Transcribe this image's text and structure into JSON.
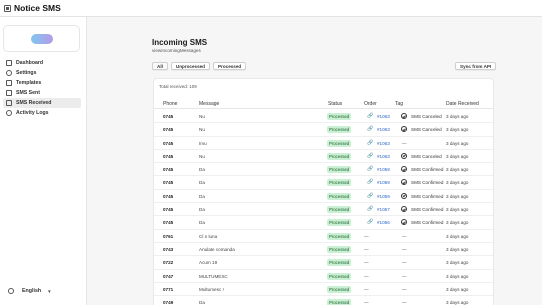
{
  "app": {
    "title": "Notice SMS"
  },
  "sidebar": {
    "items": [
      {
        "label": "Dashboard",
        "icon": "home-icon"
      },
      {
        "label": "Settings",
        "icon": "gear-icon"
      },
      {
        "label": "Templates",
        "icon": "document-icon"
      },
      {
        "label": "SMS Sent",
        "icon": "send-icon"
      },
      {
        "label": "SMS Received",
        "icon": "inbox-icon",
        "active": true
      },
      {
        "label": "Activity Logs",
        "icon": "clock-icon"
      }
    ],
    "language": "English"
  },
  "page": {
    "title": "Incoming SMS",
    "subtitle": "viewIncomingMessages",
    "filters": [
      "All",
      "Unprocessed",
      "Processed"
    ],
    "sync_label": "Sync from API",
    "total": "Total received: 109"
  },
  "table": {
    "columns": [
      "Phone",
      "Message",
      "Status",
      "Order",
      "Tag",
      "Date Received"
    ],
    "rows": [
      {
        "phone": "0745",
        "message": "Nu",
        "status": "Processed",
        "order": "#1063",
        "tag": "SMS Canceled",
        "date": "3 days ago"
      },
      {
        "phone": "0745",
        "message": "Nu",
        "status": "Processed",
        "order": "#1063",
        "tag": "SMS Canceled",
        "date": "3 days ago"
      },
      {
        "phone": "0745",
        "message": "Imu",
        "status": "Processed",
        "order": "#1063",
        "tag": "—",
        "date": "3 days ago"
      },
      {
        "phone": "0745",
        "message": "Nu",
        "status": "Processed",
        "order": "#1063",
        "tag": "SMS Canceled",
        "date": "3 days ago"
      },
      {
        "phone": "0745",
        "message": "Da",
        "status": "Processed",
        "order": "#1059",
        "tag": "SMS Confirmed",
        "date": "3 days ago"
      },
      {
        "phone": "0745",
        "message": "Da",
        "status": "Processed",
        "order": "#1059",
        "tag": "SMS Confirmed",
        "date": "3 days ago"
      },
      {
        "phone": "0745",
        "message": "Da",
        "status": "Processed",
        "order": "#1059",
        "tag": "SMS Confirmed",
        "date": "3 days ago"
      },
      {
        "phone": "0745",
        "message": "Da",
        "status": "Processed",
        "order": "#1057",
        "tag": "SMS Confirmed",
        "date": "3 days ago"
      },
      {
        "phone": "0745",
        "message": "Da",
        "status": "Processed",
        "order": "#1056",
        "tag": "SMS Confirmed",
        "date": "3 days ago"
      },
      {
        "phone": "0761",
        "message": "Cl n luna",
        "status": "Processed",
        "order": "—",
        "tag": "—",
        "date": "3 days ago"
      },
      {
        "phone": "0743",
        "message": "Anulate comanda",
        "status": "Processed",
        "order": "—",
        "tag": "—",
        "date": "3 days ago"
      },
      {
        "phone": "0722",
        "message": "Acum 19",
        "status": "Processed",
        "order": "—",
        "tag": "—",
        "date": "3 days ago"
      },
      {
        "phone": "0747",
        "message": "MULTUMESC",
        "status": "Processed",
        "order": "—",
        "tag": "—",
        "date": "3 days ago"
      },
      {
        "phone": "0771",
        "message": "Multumesc !",
        "status": "Processed",
        "order": "—",
        "tag": "—",
        "date": "3 days ago"
      },
      {
        "phone": "0749",
        "message": "Da",
        "status": "Processed",
        "order": "—",
        "tag": "—",
        "date": "3 days ago"
      }
    ]
  }
}
